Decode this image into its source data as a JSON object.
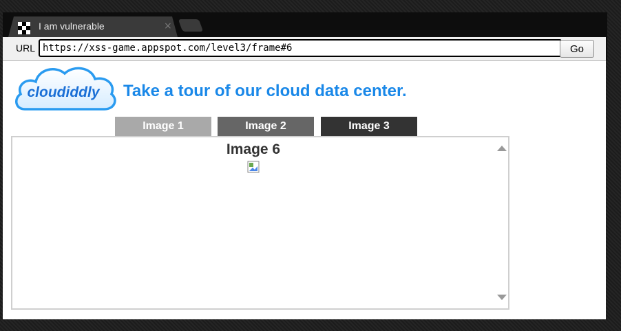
{
  "browser": {
    "tab_title": "I am vulnerable",
    "close_symbol": "×",
    "url_label": "URL",
    "url_value": "https://xss-game.appspot.com/level3/frame#6",
    "go_label": "Go"
  },
  "page": {
    "logo_text": "cloudiddly",
    "headline": "Take a tour of our cloud data center.",
    "tabs": [
      {
        "label": "Image 1"
      },
      {
        "label": "Image 2"
      },
      {
        "label": "Image 3"
      }
    ],
    "viewer_title": "Image 6"
  },
  "colors": {
    "headline": "#1a88e8",
    "tab1": "#a9a9a9",
    "tab2": "#666666",
    "tab3": "#333333"
  }
}
